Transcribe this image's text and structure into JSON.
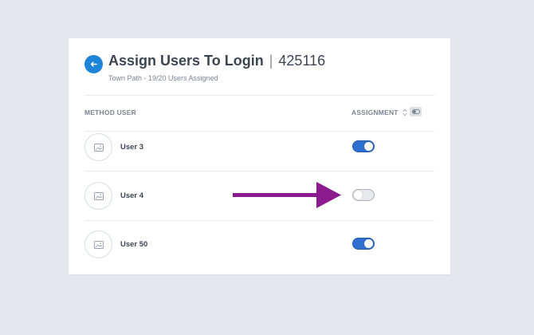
{
  "header": {
    "title": "Assign Users To Login",
    "separator": "|",
    "code": "425116",
    "subtitle": "Town Path - 19/20 Users Assigned"
  },
  "table": {
    "columns": {
      "method_user": "METHOD USER",
      "assignment": "ASSIGNMENT"
    },
    "rows": [
      {
        "name": "User 3",
        "assigned": true
      },
      {
        "name": "User 4",
        "assigned": false
      },
      {
        "name": "User 50",
        "assigned": true
      }
    ]
  },
  "icons": {
    "back": "arrow-left-icon",
    "avatar": "image-placeholder-icon",
    "sort": "sort-icon",
    "bulk_toggle": "toggle-icon",
    "annotation": "arrow-right-icon"
  },
  "colors": {
    "accent": "#1d84d8",
    "toggle_on": "#2f6fcf",
    "annotation_arrow": "#8b1a8f",
    "background": "#e4e8ec"
  }
}
